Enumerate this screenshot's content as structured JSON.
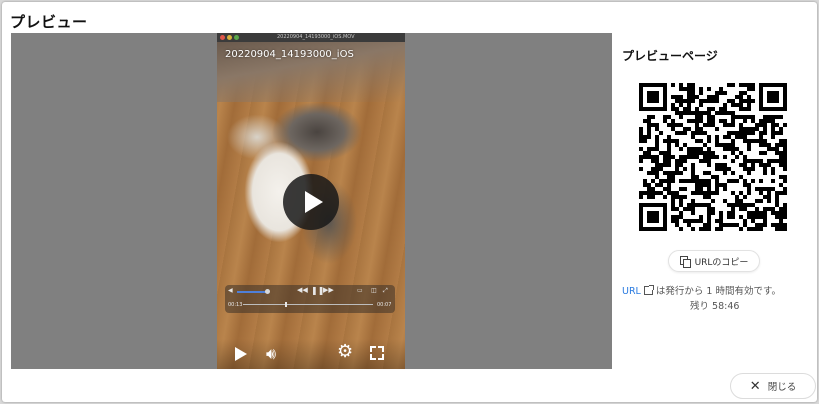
{
  "dialog": {
    "title": "プレビュー",
    "close_label": "閉じる"
  },
  "video": {
    "window_title": "20220904_14193000_iOS.MOV",
    "filename": "20220904_14193000_iOS",
    "time_elapsed": "00:13",
    "time_total": "00:07",
    "progress": 0.32,
    "volume": 0.85
  },
  "side": {
    "title": "プレビューページ",
    "copy_label": "URLのコピー",
    "url_link": "URL",
    "url_note": "は発行から 1 時間有効です。",
    "remaining_label": "残り",
    "remaining_time": "58:46"
  },
  "colors": {
    "link": "#2a7be0",
    "preview_bg": "#808080"
  },
  "icons": {
    "copy": "copy-icon",
    "close": "close-icon",
    "external": "external-link-icon"
  }
}
